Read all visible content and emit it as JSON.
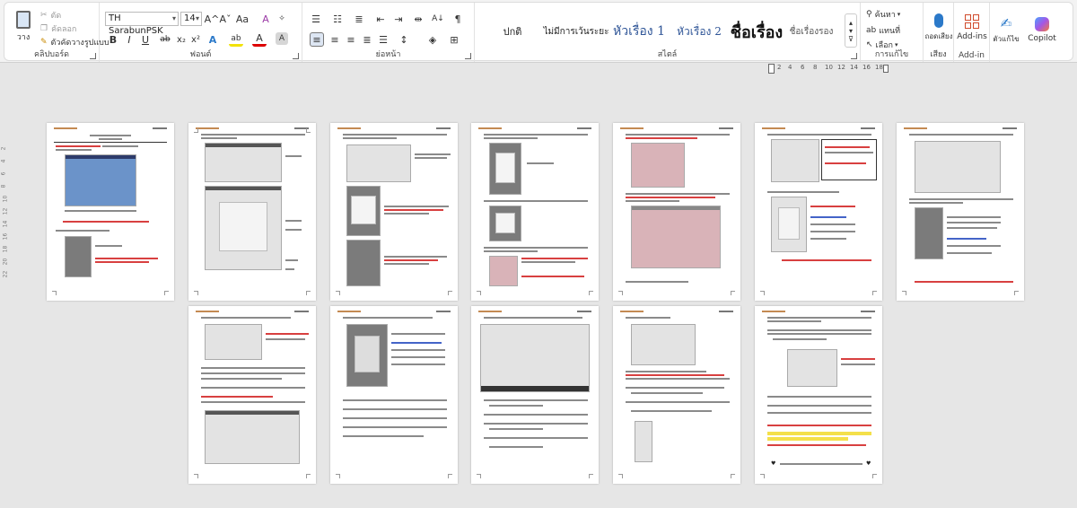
{
  "ribbon": {
    "clipboard": {
      "paste_label": "วาง",
      "cut_label": "ตัด",
      "copy_label": "คัดลอก",
      "format_painter_label": "ตัวคัดวางรูปแบบ",
      "group_label": "คลิปบอร์ด"
    },
    "font": {
      "font_name": "TH SarabunPSK",
      "font_size": "14",
      "grow_label": "A^",
      "shrink_label": "Aˇ",
      "case_label": "Aa",
      "clear_label": "A",
      "bold": "B",
      "italic": "I",
      "underline": "U",
      "strike": "ab",
      "subscript": "x₂",
      "superscript": "x²",
      "effects_label": "A",
      "highlight_label": "ab",
      "color_label": "A",
      "shade_label": "A",
      "group_label": "ฟอนต์"
    },
    "paragraph": {
      "group_label": "ย่อหน้า"
    },
    "styles": {
      "items": [
        "ปกติ",
        "ไม่มีการเว้นระยะ",
        "หัวเรื่อง 1",
        "หัวเรื่อง 2",
        "ชื่อเรื่อง",
        "ชื่อเรื่องรอง"
      ],
      "group_label": "สไตล์"
    },
    "editing": {
      "find_label": "ค้นหา",
      "replace_label": "แทนที่",
      "select_label": "เลือก",
      "group_label": "การแก้ไข"
    },
    "voice": {
      "dictate_label": "ถอดเสียง",
      "group_label": "เสียง"
    },
    "addins": {
      "label": "Add-ins",
      "group_label": "Add-in"
    },
    "editor": {
      "label": "ตัวแก้ไข"
    },
    "copilot": {
      "label": "Copilot"
    }
  },
  "ruler": {
    "numbers": [
      "2",
      "4",
      "6",
      "8",
      "10",
      "12",
      "14",
      "16",
      "18"
    ]
  },
  "vruler": {
    "numbers": [
      "2",
      "4",
      "6",
      "8",
      "10",
      "12",
      "14",
      "16",
      "18",
      "20",
      "22"
    ]
  },
  "colors": {
    "accent": "#2b579a",
    "red_text": "#d84040",
    "page_bg": "#ffffff",
    "canvas": "#e6e6e6"
  }
}
